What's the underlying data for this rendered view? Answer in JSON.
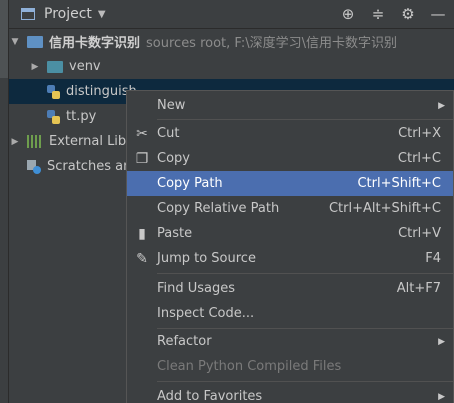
{
  "header": {
    "title": "Project"
  },
  "tree": {
    "root": {
      "name": "信用卡数字识别",
      "meta": "sources root,  F:\\深度学习\\信用卡数字识别"
    },
    "venv": "venv",
    "file1": "distinguish",
    "file2": "tt.py",
    "external": "External Libraries",
    "scratches": "Scratches and Consoles"
  },
  "menu": {
    "items": [
      {
        "label": "New",
        "shortcut": "",
        "icon": "none",
        "submenu": true
      },
      {
        "label": "Cut",
        "shortcut": "Ctrl+X",
        "icon": "scissors-icon"
      },
      {
        "label": "Copy",
        "shortcut": "Ctrl+C",
        "icon": "copy-icon"
      },
      {
        "label": "Copy Path",
        "shortcut": "Ctrl+Shift+C",
        "icon": "none",
        "active": true
      },
      {
        "label": "Copy Relative Path",
        "shortcut": "Ctrl+Alt+Shift+C",
        "icon": "none"
      },
      {
        "label": "Paste",
        "shortcut": "Ctrl+V",
        "icon": "clipboard-icon"
      },
      {
        "label": "Jump to Source",
        "shortcut": "F4",
        "icon": "pencil-icon"
      },
      {
        "label": "Find Usages",
        "shortcut": "Alt+F7",
        "icon": "none"
      },
      {
        "label": "Inspect Code...",
        "shortcut": "",
        "icon": "none"
      },
      {
        "label": "Refactor",
        "shortcut": "",
        "icon": "none",
        "submenu": true
      },
      {
        "label": "Clean Python Compiled Files",
        "shortcut": "",
        "icon": "none",
        "disabled": true
      },
      {
        "label": "Add to Favorites",
        "shortcut": "",
        "icon": "none",
        "submenu": true
      }
    ]
  },
  "colors": {
    "background": "#3c3f41",
    "selection_tree": "#0d293e",
    "selection_menu": "#4b6eaf"
  }
}
